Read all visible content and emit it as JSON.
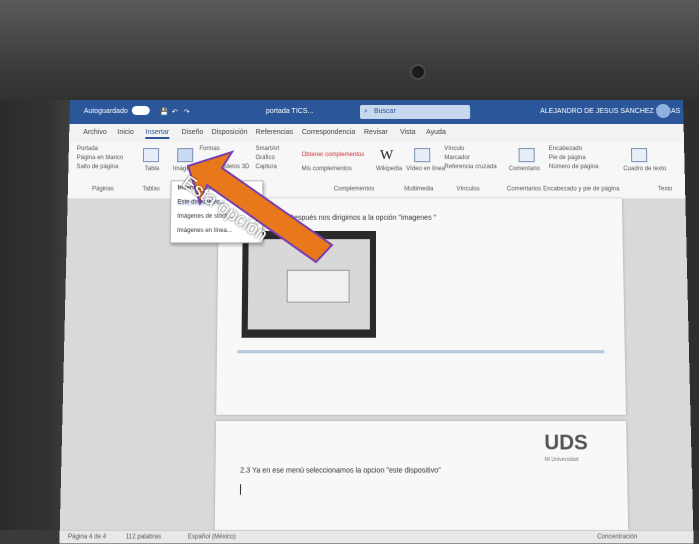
{
  "titlebar": {
    "autosave": "Autoguardado",
    "doc_name": "portada TICS...",
    "search_placeholder": "Buscar",
    "user_name": "ALEJANDRO DE JESUS SANCHEZ ROSAS"
  },
  "tabs": [
    "Archivo",
    "Inicio",
    "Insertar",
    "Diseño",
    "Disposición",
    "Referencias",
    "Correspondencia",
    "Revisar",
    "Vista",
    "Ayuda"
  ],
  "ribbon": {
    "pages": [
      "Portada",
      "Página en blanco",
      "Salto de página"
    ],
    "pages_group": "Páginas",
    "table_label": "Tabla",
    "tables_group": "Tablas",
    "images_label": "Imágenes",
    "formas": "Formas",
    "smartart": "SmartArt",
    "grafico": "Gráfico",
    "captura": "Captura",
    "modelos": "Modelos 3D",
    "complementos": [
      "Obtener complementos",
      "Mis complementos"
    ],
    "complementos_group": "Complementos",
    "wikipedia": "Wikipedia",
    "video": "Vídeo en línea",
    "multimedia_group": "Multimedia",
    "vinculos": [
      "Vínculo",
      "Marcador",
      "Referencia cruzada"
    ],
    "vinculos_group": "Vínculos",
    "comentario": "Comentario",
    "comentarios_group": "Comentarios",
    "header_footer": [
      "Encabezado",
      "Pie de página",
      "Número de página"
    ],
    "header_footer_group": "Encabezado y pie de página",
    "cuadro_texto": "Cuadro de texto",
    "texto_group": "Texto"
  },
  "menu": {
    "items": [
      "Insertar imagen desde",
      "Este dispositivo...",
      "Imágenes de stock...",
      "Imágenes en línea..."
    ]
  },
  "annotation": {
    "text": "Esta opción",
    "color": "#e8781a",
    "border_color": "#7a3fb0"
  },
  "document": {
    "line1": "2.2 Después nos dirigimos a la opción \"imagenes \"",
    "line2": "2.3 Ya en ese menú seleccionamos la opcion \"este dispositivo\"",
    "logo": "UDS",
    "logo_sub": "Mi Universidad"
  },
  "statusbar": {
    "page": "Página 4 de 4",
    "words": "112 palabras",
    "language": "Español (México)",
    "focus": "Concentración"
  }
}
